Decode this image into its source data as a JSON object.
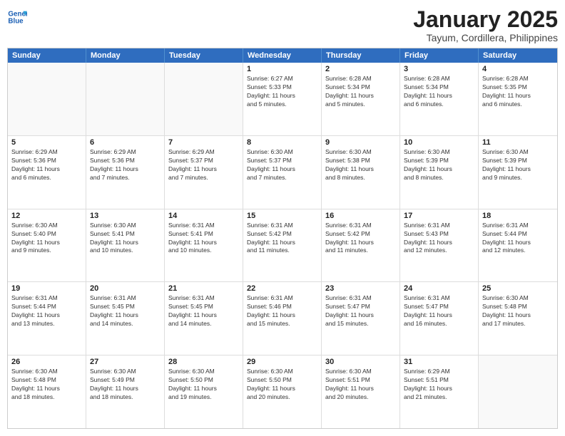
{
  "header": {
    "logo_line1": "General",
    "logo_line2": "Blue",
    "title": "January 2025",
    "subtitle": "Tayum, Cordillera, Philippines"
  },
  "weekdays": [
    "Sunday",
    "Monday",
    "Tuesday",
    "Wednesday",
    "Thursday",
    "Friday",
    "Saturday"
  ],
  "rows": [
    [
      {
        "day": "",
        "info": ""
      },
      {
        "day": "",
        "info": ""
      },
      {
        "day": "",
        "info": ""
      },
      {
        "day": "1",
        "info": "Sunrise: 6:27 AM\nSunset: 5:33 PM\nDaylight: 11 hours\nand 5 minutes."
      },
      {
        "day": "2",
        "info": "Sunrise: 6:28 AM\nSunset: 5:34 PM\nDaylight: 11 hours\nand 5 minutes."
      },
      {
        "day": "3",
        "info": "Sunrise: 6:28 AM\nSunset: 5:34 PM\nDaylight: 11 hours\nand 6 minutes."
      },
      {
        "day": "4",
        "info": "Sunrise: 6:28 AM\nSunset: 5:35 PM\nDaylight: 11 hours\nand 6 minutes."
      }
    ],
    [
      {
        "day": "5",
        "info": "Sunrise: 6:29 AM\nSunset: 5:36 PM\nDaylight: 11 hours\nand 6 minutes."
      },
      {
        "day": "6",
        "info": "Sunrise: 6:29 AM\nSunset: 5:36 PM\nDaylight: 11 hours\nand 7 minutes."
      },
      {
        "day": "7",
        "info": "Sunrise: 6:29 AM\nSunset: 5:37 PM\nDaylight: 11 hours\nand 7 minutes."
      },
      {
        "day": "8",
        "info": "Sunrise: 6:30 AM\nSunset: 5:37 PM\nDaylight: 11 hours\nand 7 minutes."
      },
      {
        "day": "9",
        "info": "Sunrise: 6:30 AM\nSunset: 5:38 PM\nDaylight: 11 hours\nand 8 minutes."
      },
      {
        "day": "10",
        "info": "Sunrise: 6:30 AM\nSunset: 5:39 PM\nDaylight: 11 hours\nand 8 minutes."
      },
      {
        "day": "11",
        "info": "Sunrise: 6:30 AM\nSunset: 5:39 PM\nDaylight: 11 hours\nand 9 minutes."
      }
    ],
    [
      {
        "day": "12",
        "info": "Sunrise: 6:30 AM\nSunset: 5:40 PM\nDaylight: 11 hours\nand 9 minutes."
      },
      {
        "day": "13",
        "info": "Sunrise: 6:30 AM\nSunset: 5:41 PM\nDaylight: 11 hours\nand 10 minutes."
      },
      {
        "day": "14",
        "info": "Sunrise: 6:31 AM\nSunset: 5:41 PM\nDaylight: 11 hours\nand 10 minutes."
      },
      {
        "day": "15",
        "info": "Sunrise: 6:31 AM\nSunset: 5:42 PM\nDaylight: 11 hours\nand 11 minutes."
      },
      {
        "day": "16",
        "info": "Sunrise: 6:31 AM\nSunset: 5:42 PM\nDaylight: 11 hours\nand 11 minutes."
      },
      {
        "day": "17",
        "info": "Sunrise: 6:31 AM\nSunset: 5:43 PM\nDaylight: 11 hours\nand 12 minutes."
      },
      {
        "day": "18",
        "info": "Sunrise: 6:31 AM\nSunset: 5:44 PM\nDaylight: 11 hours\nand 12 minutes."
      }
    ],
    [
      {
        "day": "19",
        "info": "Sunrise: 6:31 AM\nSunset: 5:44 PM\nDaylight: 11 hours\nand 13 minutes."
      },
      {
        "day": "20",
        "info": "Sunrise: 6:31 AM\nSunset: 5:45 PM\nDaylight: 11 hours\nand 14 minutes."
      },
      {
        "day": "21",
        "info": "Sunrise: 6:31 AM\nSunset: 5:45 PM\nDaylight: 11 hours\nand 14 minutes."
      },
      {
        "day": "22",
        "info": "Sunrise: 6:31 AM\nSunset: 5:46 PM\nDaylight: 11 hours\nand 15 minutes."
      },
      {
        "day": "23",
        "info": "Sunrise: 6:31 AM\nSunset: 5:47 PM\nDaylight: 11 hours\nand 15 minutes."
      },
      {
        "day": "24",
        "info": "Sunrise: 6:31 AM\nSunset: 5:47 PM\nDaylight: 11 hours\nand 16 minutes."
      },
      {
        "day": "25",
        "info": "Sunrise: 6:30 AM\nSunset: 5:48 PM\nDaylight: 11 hours\nand 17 minutes."
      }
    ],
    [
      {
        "day": "26",
        "info": "Sunrise: 6:30 AM\nSunset: 5:48 PM\nDaylight: 11 hours\nand 18 minutes."
      },
      {
        "day": "27",
        "info": "Sunrise: 6:30 AM\nSunset: 5:49 PM\nDaylight: 11 hours\nand 18 minutes."
      },
      {
        "day": "28",
        "info": "Sunrise: 6:30 AM\nSunset: 5:50 PM\nDaylight: 11 hours\nand 19 minutes."
      },
      {
        "day": "29",
        "info": "Sunrise: 6:30 AM\nSunset: 5:50 PM\nDaylight: 11 hours\nand 20 minutes."
      },
      {
        "day": "30",
        "info": "Sunrise: 6:30 AM\nSunset: 5:51 PM\nDaylight: 11 hours\nand 20 minutes."
      },
      {
        "day": "31",
        "info": "Sunrise: 6:29 AM\nSunset: 5:51 PM\nDaylight: 11 hours\nand 21 minutes."
      },
      {
        "day": "",
        "info": ""
      }
    ]
  ]
}
